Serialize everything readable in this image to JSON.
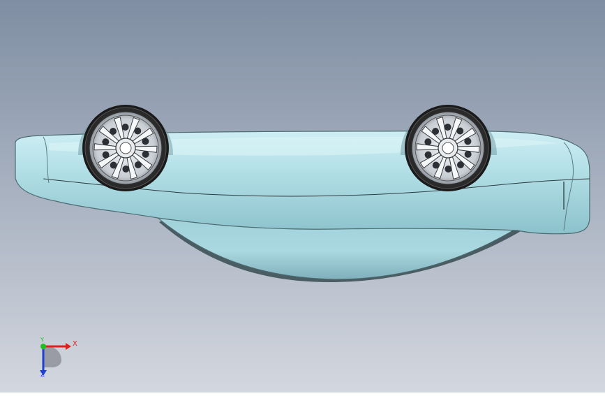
{
  "viewport": {
    "background_top": "#7f8ea3",
    "background_bottom": "#cdd2dc",
    "model": "car-body-upside-down",
    "body_color": "#a9d7e0",
    "body_shadow": "#7fb3bf",
    "body_highlight": "#d7f1f5",
    "tire_color": "#1a1a1a",
    "rim_color": "#c8cdd2"
  },
  "triad": {
    "x_label": "X",
    "y_label": "Y",
    "z_label": "Z",
    "x_color": "#e02020",
    "y_color": "#20c020",
    "z_color": "#2040d0"
  }
}
